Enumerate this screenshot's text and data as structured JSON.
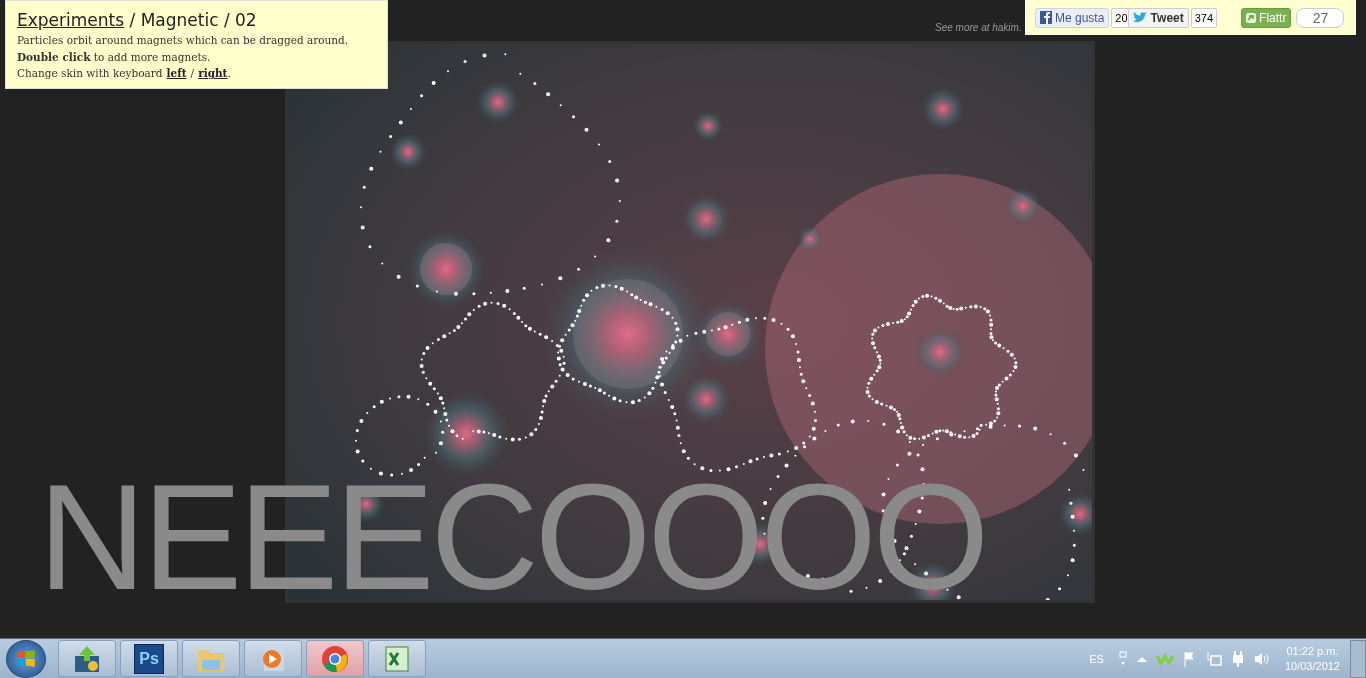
{
  "info": {
    "title_link": "Experiments",
    "title_rest": "/ Magnetic / 02",
    "lines": [
      "Particles orbit around magnets which can be dragged around.",
      "**Double click** to add more magnets."
    ],
    "skin_line": {
      "text": "Change skin with keyboard",
      "links": [
        "left",
        "right"
      ],
      "separator": "/",
      "end": "."
    }
  },
  "see_more": "See more at hakim.",
  "share": {
    "like_label": "Me gusta",
    "like_count": "20",
    "tweet_label": "Tweet",
    "tweet_count": "374",
    "flattr_label": "Flattr",
    "flattr_count": "27"
  },
  "background_text": "NEEECOOOO",
  "taskbar": {
    "apps": [
      {
        "kind": "update",
        "selected": false
      },
      {
        "kind": "photoshop",
        "label": "Ps",
        "selected": false
      },
      {
        "kind": "folder",
        "selected": false
      },
      {
        "kind": "media",
        "selected": false
      },
      {
        "kind": "chrome",
        "selected": true
      },
      {
        "kind": "excel",
        "selected": false
      }
    ],
    "tray": {
      "language": "ES",
      "time": "01:22 p.m.",
      "date": "10/03/2012"
    }
  }
}
